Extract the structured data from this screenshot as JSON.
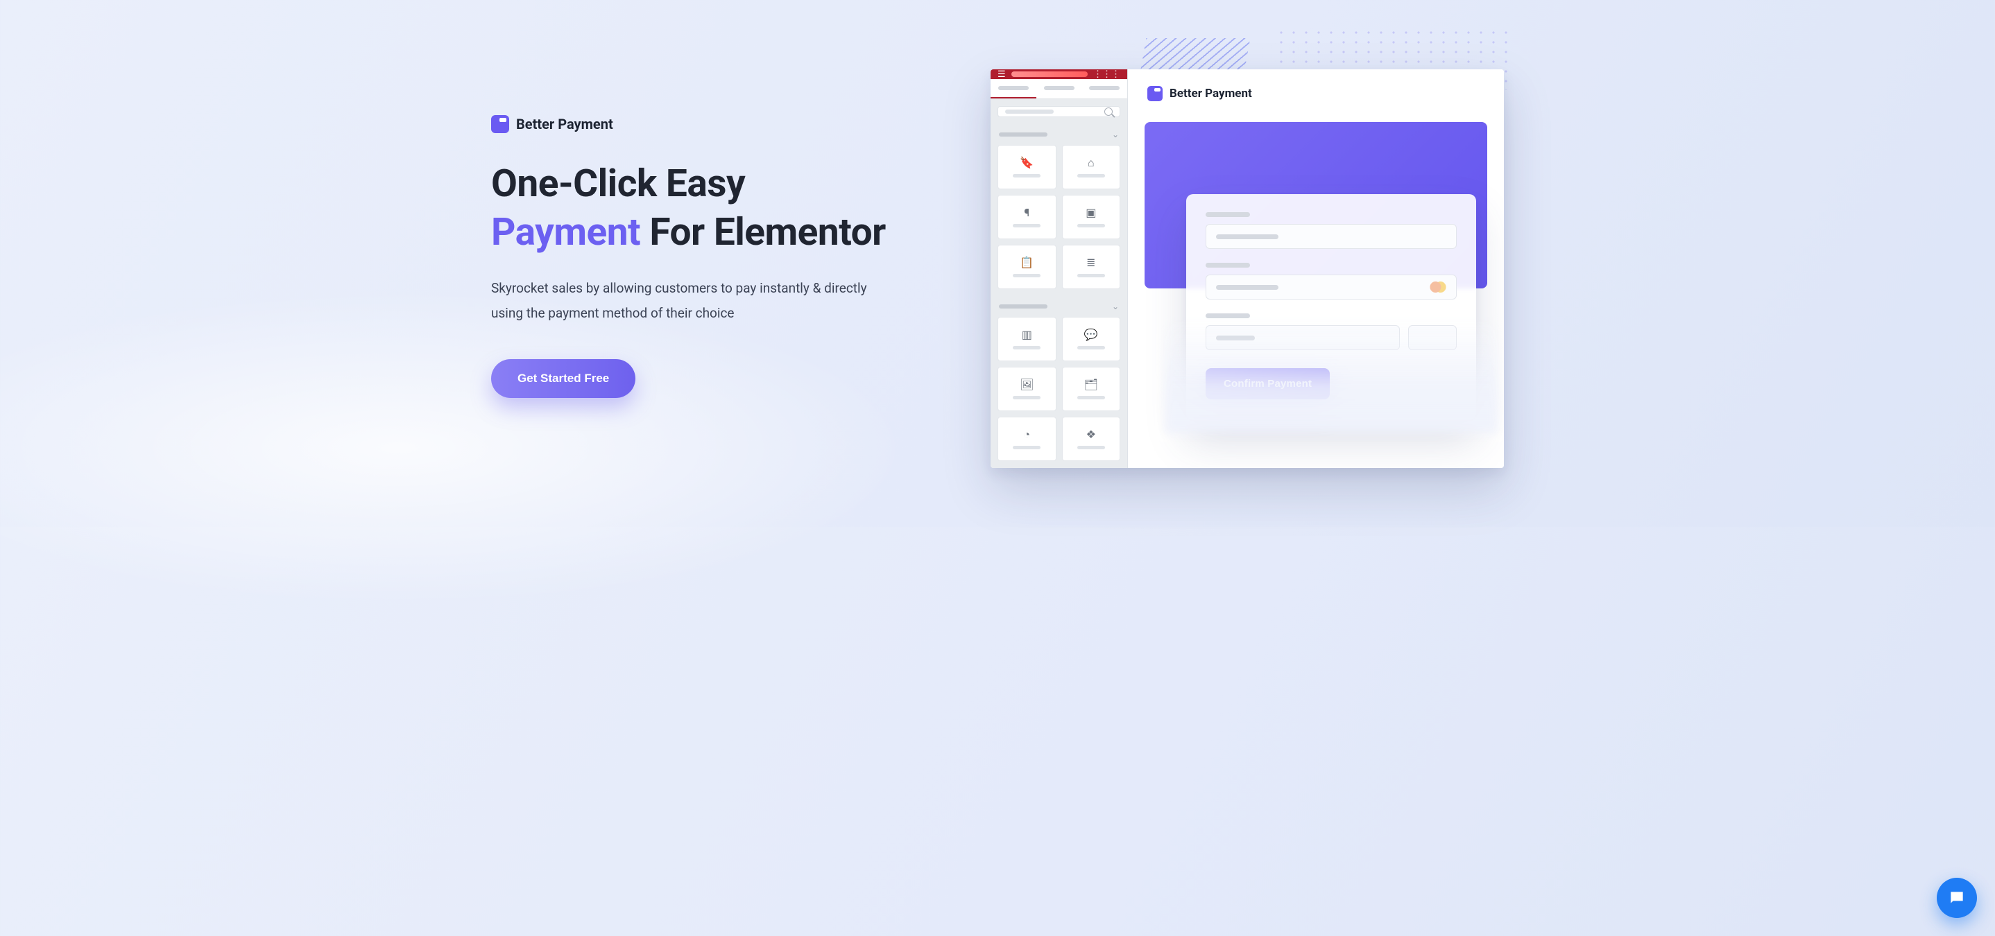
{
  "brand": {
    "name": "Better Payment"
  },
  "headline": {
    "line1": "One-Click Easy",
    "accent": "Payment",
    "line2_rest": " For Elementor"
  },
  "subhead": "Skyrocket sales by allowing customers to pay instantly & directly using the payment method of their choice",
  "cta_label": "Get Started Free",
  "mock": {
    "canvas_title": "Better Payment",
    "confirm_label": "Confirm Payment"
  }
}
